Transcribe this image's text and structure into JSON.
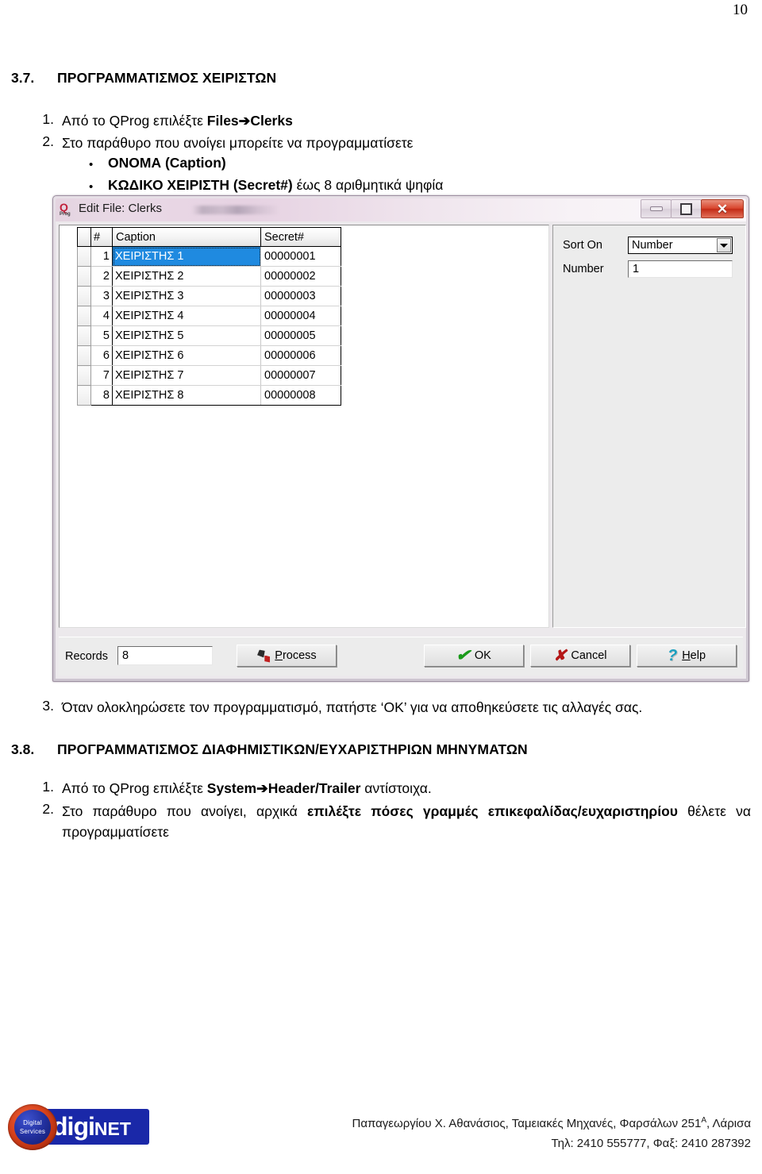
{
  "page": {
    "number": "10"
  },
  "sections": {
    "s37": {
      "num": "3.7.",
      "title": "ΠΡΟΓΡΑΜΜΑΤΙΣΜΟΣ ΧΕΙΡΙΣΤΩΝ",
      "item1_num": "1.",
      "item1_pre": "Από το QProg επιλέξτε ",
      "item1_bold": "Files➔Clerks",
      "item2_num": "2.",
      "item2_text": "Στο παράθυρο που ανοίγει μπορείτε να προγραμματίσετε",
      "bullet1_bold": "ΟΝΟΜΑ (Caption)",
      "bullet2_bold": "ΚΩΔΙΚΟ ΧΕΙΡΙΣΤΗ (Secret#)",
      "bullet2_rest": " έως 8 αριθμητικά ψηφία",
      "item3_num": "3.",
      "item3_text": "Όταν ολοκληρώσετε τον προγραμματισμό, πατήστε ‘ΟΚ’ για να αποθηκεύσετε τις αλλαγές σας."
    },
    "s38": {
      "num": "3.8.",
      "title": "ΠΡΟΓΡΑΜΜΑΤΙΣΜΟΣ ΔΙΑΦΗΜΙΣΤΙΚΩΝ/ΕΥΧΑΡΙΣΤΗΡΙΩΝ ΜΗΝΥΜΑΤΩΝ",
      "item1_num": "1.",
      "item1_pre": "Από το QProg επιλέξτε ",
      "item1_bold": "System➔Header/Trailer",
      "item1_post": " αντίστοιχα.",
      "item2_num": "2.",
      "item2_pre": "Στο παράθυρο που ανοίγει, αρχικά ",
      "item2_bold": "επιλέξτε πόσες γραμμές επικεφαλίδας/ευχαριστηρίου",
      "item2_post": " θέλετε να προγραμματίσετε"
    }
  },
  "app_window": {
    "title": "Edit File: Clerks",
    "icon_q": "Q",
    "icon_prog": "Prog",
    "buttons": {
      "minimize": "minimize",
      "maximize": "maximize",
      "close": "✕"
    },
    "grid": {
      "headers": [
        "#",
        "Caption",
        "Secret#"
      ],
      "rows": [
        {
          "n": "1",
          "caption": "ΧΕΙΡΙΣΤΗΣ 1",
          "secret": "00000001",
          "selected": true
        },
        {
          "n": "2",
          "caption": "ΧΕΙΡΙΣΤΗΣ 2",
          "secret": "00000002",
          "selected": false
        },
        {
          "n": "3",
          "caption": "ΧΕΙΡΙΣΤΗΣ 3",
          "secret": "00000003",
          "selected": false
        },
        {
          "n": "4",
          "caption": "ΧΕΙΡΙΣΤΗΣ 4",
          "secret": "00000004",
          "selected": false
        },
        {
          "n": "5",
          "caption": "ΧΕΙΡΙΣΤΗΣ 5",
          "secret": "00000005",
          "selected": false
        },
        {
          "n": "6",
          "caption": "ΧΕΙΡΙΣΤΗΣ 6",
          "secret": "00000006",
          "selected": false
        },
        {
          "n": "7",
          "caption": "ΧΕΙΡΙΣΤΗΣ 7",
          "secret": "00000007",
          "selected": false
        },
        {
          "n": "8",
          "caption": "ΧΕΙΡΙΣΤΗΣ 8",
          "secret": "00000008",
          "selected": false
        }
      ]
    },
    "side_panel": {
      "sort_on_label": "Sort On",
      "sort_on_value": "Number",
      "number_label": "Number",
      "number_value": "1"
    },
    "bottom_bar": {
      "records_label": "Records",
      "records_value": "8",
      "process_label": "Process",
      "process_accel": "P",
      "ok_label": "OK",
      "cancel_label": "Cancel",
      "help_label": "Help",
      "help_accel": "H"
    }
  },
  "footer": {
    "logo_word_1": "dig",
    "logo_word_i": "i",
    "logo_word_2": "NET",
    "logo_badge_line1": "Digital",
    "logo_badge_line2": "Services",
    "line1_pre": "Παπαγεωργίου Χ. Αθανάσιος, Ταμειακές Μηχανές, Φαρσάλων 251",
    "line1_sup": "Α",
    "line1_post": ", Λάρισα",
    "line2": "Τηλ: 2410 555777, Φαξ: 2410 287392"
  },
  "colors": {
    "selection_blue": "#1f8ae0",
    "close_red": "#c32b16",
    "ok_green": "#1a9a1a",
    "cancel_red": "#b41616",
    "help_cyan": "#1aa0c0",
    "logo_blue": "#1a28a8",
    "logo_orange": "#d9431c"
  }
}
